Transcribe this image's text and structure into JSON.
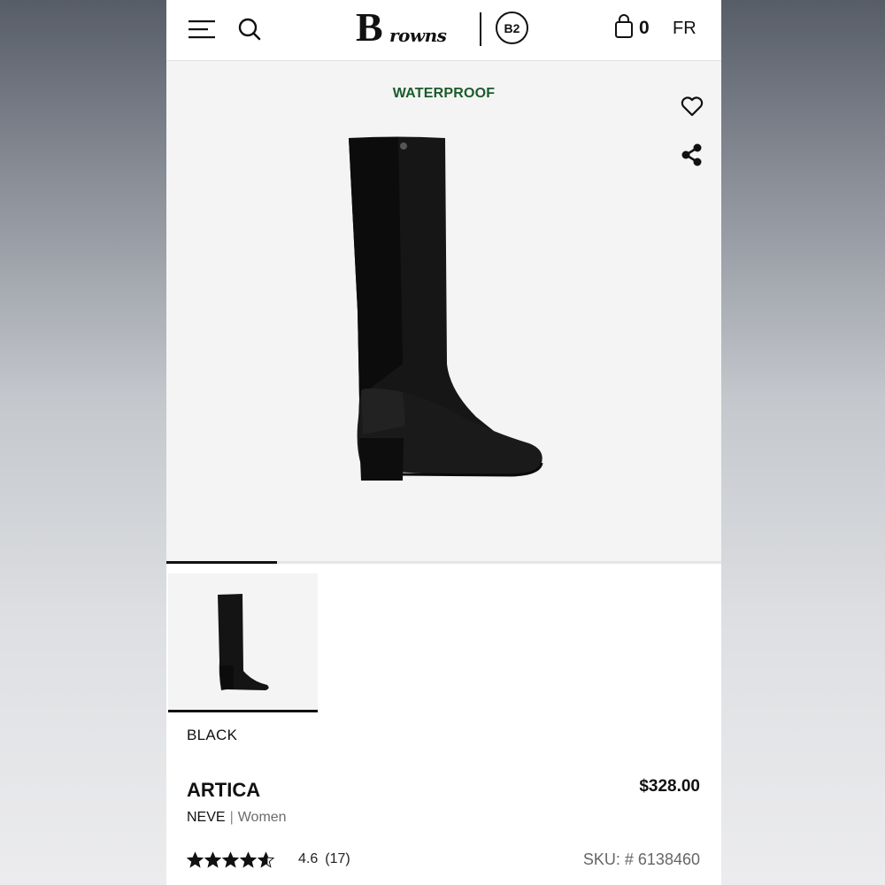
{
  "header": {
    "logo_initial": "B",
    "logo_rest": "rowns",
    "logo_badge": "B2",
    "cart_count": "0",
    "language": "FR",
    "icons": [
      "hamburger-menu-icon",
      "search-icon",
      "shopping-bag-icon"
    ]
  },
  "gallery": {
    "badge": "WATERPROOF",
    "icons": [
      "heart-icon",
      "share-icon"
    ],
    "slide_progress": 0.2,
    "image_description_icon": "knee-high-black-boot"
  },
  "product": {
    "color": "BLACK",
    "name": "ARTICA",
    "price": "$328.00",
    "brand": "NEVE",
    "separator": "|",
    "gender": "Women",
    "rating_value": "4.6",
    "rating_count": "(17)",
    "rating_stars": 4.6,
    "sku": "SKU: # 6138460"
  },
  "colors": {
    "accent_green": "#1b5b2c",
    "text": "#111111",
    "muted": "#666666",
    "gallery_bg": "#f4f4f4"
  }
}
